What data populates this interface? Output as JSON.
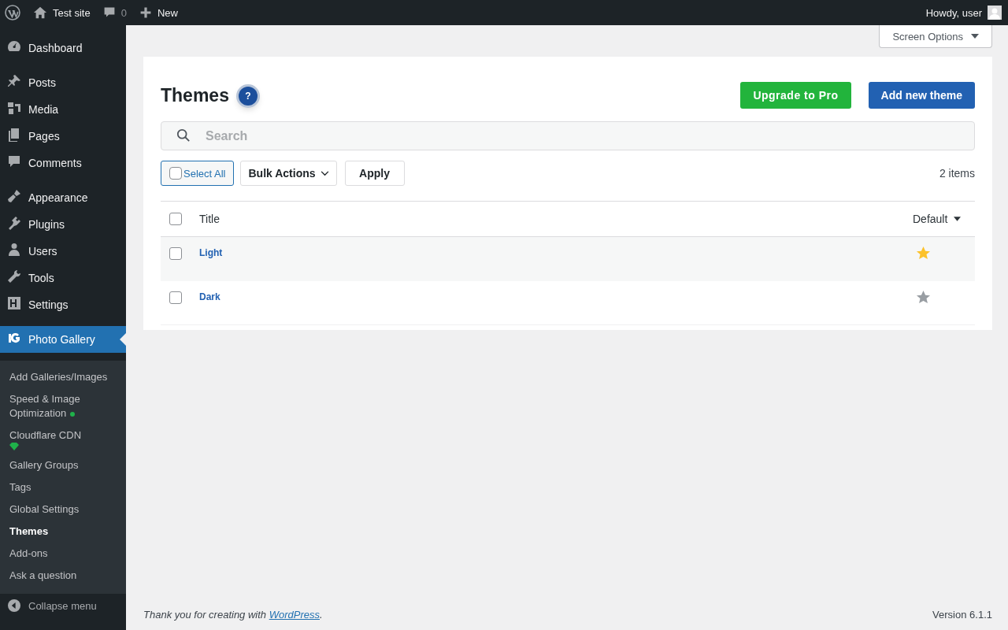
{
  "admin_bar": {
    "site": "Test site",
    "comments": "0",
    "new": "New",
    "greeting": "Howdy, user"
  },
  "sidebar": {
    "groups": [
      [
        {
          "label": "Dashboard",
          "selected": false
        }
      ],
      [
        {
          "label": "Posts",
          "selected": false
        },
        {
          "label": "Media",
          "selected": false
        },
        {
          "label": "Pages",
          "selected": false
        },
        {
          "label": "Comments",
          "selected": false
        }
      ],
      [
        {
          "label": "Appearance",
          "selected": false
        },
        {
          "label": "Plugins",
          "selected": false
        },
        {
          "label": "Users",
          "selected": false
        },
        {
          "label": "Tools",
          "selected": false
        },
        {
          "label": "Settings",
          "selected": false
        }
      ],
      [
        {
          "label": "Photo Gallery",
          "selected": true
        }
      ]
    ],
    "submenu": [
      {
        "label": "Add Galleries/Images",
        "selected": false,
        "kind": "plain"
      },
      {
        "label": "Speed & Image Optimization",
        "selected": false,
        "kind": "dot"
      },
      {
        "label": "Cloudflare CDN",
        "selected": false,
        "kind": "diamond"
      },
      {
        "label": "Gallery Groups",
        "selected": false,
        "kind": "plain"
      },
      {
        "label": "Tags",
        "selected": false,
        "kind": "plain"
      },
      {
        "label": "Global Settings",
        "selected": false,
        "kind": "plain"
      },
      {
        "label": "Themes",
        "selected": true,
        "kind": "plain"
      },
      {
        "label": "Add-ons",
        "selected": false,
        "kind": "plain"
      },
      {
        "label": "Ask a question",
        "selected": false,
        "kind": "plain"
      }
    ],
    "collapse": "Collapse menu"
  },
  "screen_options": "Screen Options",
  "page": {
    "title": "Themes",
    "help": "?",
    "upgrade_button": "Upgrade to Pro",
    "add_button": "Add new theme",
    "search": {
      "placeholder": "Search"
    },
    "select_all": {
      "label": "Select All",
      "checked": false
    },
    "bulk_actions": "Bulk Actions",
    "apply": "Apply",
    "count": "2 items",
    "table": {
      "header_checked": false,
      "columns": [
        "Title",
        "Default"
      ],
      "rows": [
        {
          "title": "Light",
          "checked": false,
          "default": true
        },
        {
          "title": "Dark",
          "checked": false,
          "default": false
        }
      ]
    }
  },
  "footer": {
    "thanks_prefix": "Thank you for creating with ",
    "link": "WordPress",
    "thanks_suffix": ".",
    "version": "Version 6.1.1"
  }
}
